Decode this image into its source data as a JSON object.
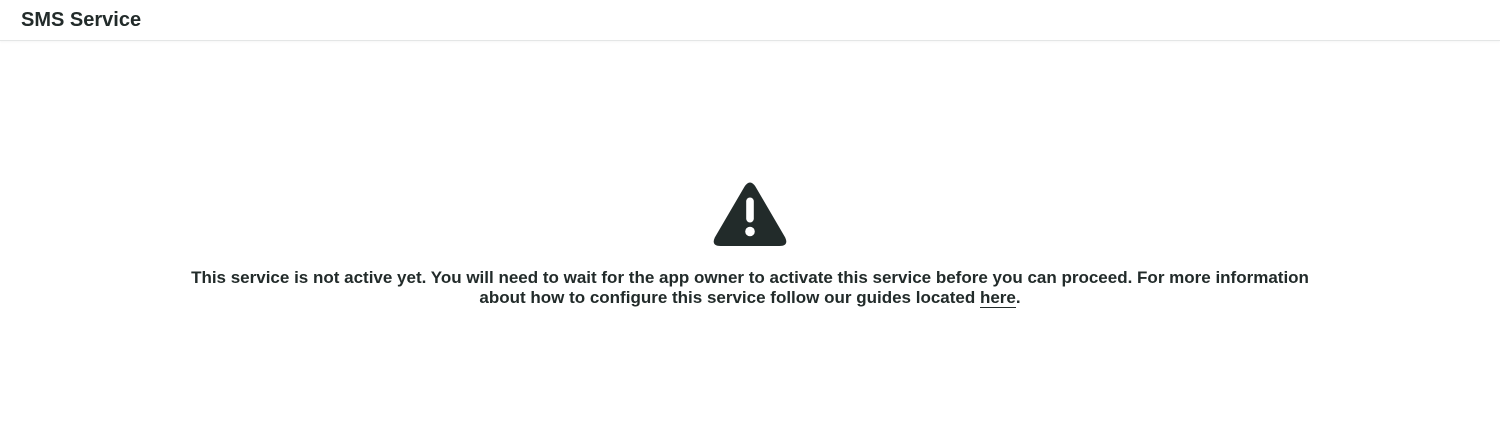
{
  "header": {
    "title": "SMS Service"
  },
  "notice": {
    "icon": "warning-icon",
    "icon_color": "#222b2a",
    "message_main": "This service is not active yet. You will need to wait for the app owner to activate this service before you can proceed. For more information about how to configure this service follow our guides located ",
    "link_label": "here",
    "message_end": "."
  }
}
